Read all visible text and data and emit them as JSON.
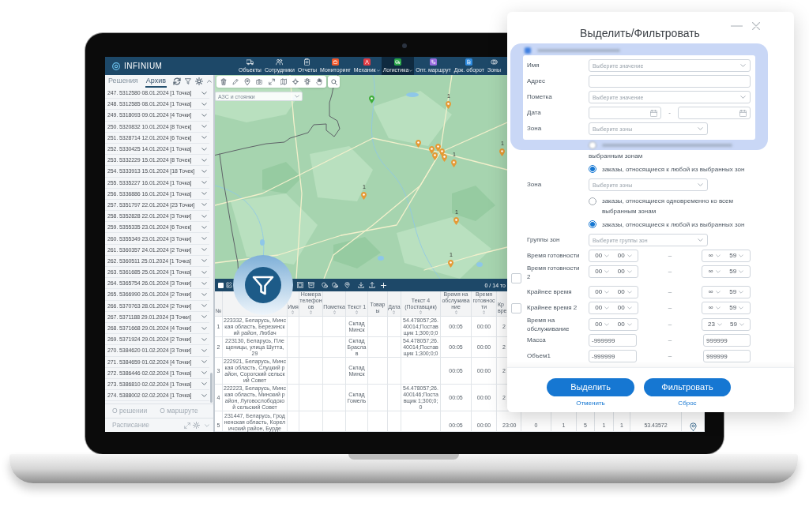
{
  "app": {
    "logo": "INFINIUM",
    "nav": [
      {
        "label": "Объекты",
        "kind": "outline",
        "has_menu": false,
        "selected": false
      },
      {
        "label": "Сотрудники",
        "kind": "outline",
        "has_menu": false,
        "selected": false
      },
      {
        "label": "Отчеты",
        "kind": "outline",
        "has_menu": false,
        "selected": false
      },
      {
        "label": "Мониторинг",
        "kind": "tile",
        "color": "#f0582c",
        "has_menu": false,
        "selected": false
      },
      {
        "label": "Механик",
        "kind": "tile",
        "color": "#e23d45",
        "has_menu": true,
        "selected": false
      },
      {
        "label": "Логистика",
        "kind": "tile",
        "color": "#2aa84a",
        "has_menu": true,
        "selected": true
      },
      {
        "label": "Опт. маршрут",
        "kind": "tile",
        "color": "#9a6ee0",
        "has_menu": false,
        "selected": false
      },
      {
        "label": "Док. оборот",
        "kind": "tile",
        "color": "#2e8be0",
        "has_menu": false,
        "selected": false
      },
      {
        "label": "Зоны",
        "kind": "outline",
        "has_menu": false,
        "selected": false
      }
    ]
  },
  "sidebar": {
    "tabs": [
      {
        "label": "Решения",
        "selected": false
      },
      {
        "label": "Архив",
        "selected": true
      }
    ],
    "items": [
      "247. 5312580 08.01.2024 [1 Точка]",
      "248. 5312585 08.01.2024 [1 Точка]",
      "249. 5318093 09.01.2024 [4 Точки]",
      "250. 5320832 10.01.2024 [8 Точек]",
      "251. 5328714 12.01.2024 [6 Точек]",
      "252. 5330425 14.01.2024 [1 Точка]",
      "253. 5332229 15.01.2024 [8 Точек]",
      "254. 5333913 15.01.2024 [18 Точек]",
      "255. 5335227 16.01.2024 [1 Точка]",
      "256. 5336886 16.01.2024 [1 Точка]",
      "257. 5351797 22.01.2024 [23 Точки]",
      "258. 5352828 22.01.2024 [3 Точки]",
      "259. 5355335 23.01.2024 [6 Точек]",
      "260. 5355349 23.01.2024 [3 Точки]",
      "261. 5360357 24.01.2024 [2 Точки]",
      "262. 5360511 25.01.2024 [1 Точка]",
      "263. 5361685 25.01.2024 [1 Точка]",
      "264. 5365754 26.01.2024 [3 Точки]",
      "265. 5366990 26.01.2024 [2 Точки]",
      "266. 5370763 28.01.2024 [2 Точки]",
      "267. 5371188 29.01.2024 [3 Точки]",
      "268. 5371668 29.01.2024 [4 Точки]",
      "269. 5371924 29.01.2024 [2 Точки]",
      "270. 5384620 01.02.2024 [3 Точки]",
      "271. 5384659 01.02.2024 [4 Точки]",
      "272. 5386446 02.02.2024 [1 Точка]",
      "273. 5386810 02.02.2024 [1 Точка]",
      "274. 5388002 02.02.2024 [1 Точка]"
    ],
    "sections": [
      {
        "label": "О решении"
      },
      {
        "label": "О маршруте"
      }
    ],
    "schedule": {
      "label": "Расписание"
    }
  },
  "map": {
    "layer_select": "АЗС и стоянки",
    "markers": [
      {
        "color": "#3fae3a"
      },
      {
        "color": "#e59a35",
        "label": "1"
      },
      {
        "color": "#e59a35"
      },
      {
        "color": "#e59a35"
      },
      {
        "color": "#e59a35"
      },
      {
        "color": "#e59a35"
      },
      {
        "color": "#e59a35"
      },
      {
        "color": "#e59a35"
      },
      {
        "color": "#e59a35",
        "label": "1"
      },
      {
        "color": "#e59a35",
        "label": "1"
      },
      {
        "color": "#e59a35",
        "label": "1"
      },
      {
        "color": "#e59a35",
        "label": "1"
      },
      {
        "color": "#e59a35",
        "label": "1"
      }
    ]
  },
  "table": {
    "select_all_checked": false,
    "counter": "0 / 14 то",
    "columns": [
      {
        "label": "№",
        "sortable": false
      },
      null,
      {
        "label": "Имя",
        "sortable": true
      },
      {
        "label": "Номера телефонов",
        "sortable": true
      },
      {
        "label": "Пометка",
        "sortable": true
      },
      {
        "label": "Текст 1",
        "sortable": true
      },
      {
        "label": "Товары",
        "sortable": false
      },
      {
        "label": "Дата",
        "sortable": true
      },
      {
        "label": "Текст 4 (Поставщик)",
        "sortable": true
      },
      {
        "label": "Время на обслуживание",
        "sortable": true
      },
      {
        "label": "Время готовности",
        "sortable": true
      },
      {
        "label": "Кр вре",
        "sortable": false
      }
    ],
    "rows": [
      {
        "cells": [
          "1",
          "223332, Беларусь, Минская область, Березинский район, Любач",
          null,
          null,
          null,
          "Склад Минск",
          null,
          null,
          "54.478057;26.40014;Поставщик 1;300;0;0",
          "00:05",
          "00:00",
          "2"
        ]
      },
      {
        "cells": [
          "2",
          "223130, Беларусь, Плещеницы, улица Шутта, 29",
          null,
          null,
          null,
          "Склад Браслав",
          null,
          null,
          "54.478057;26.40014;Поставщик 1;300;0;0",
          "00:05",
          "00:00",
          "2"
        ]
      },
      {
        "cells": [
          "3",
          "222921, Беларусь, Минская область, Слуцкий район, Сорогский сельский Совет",
          null,
          null,
          null,
          "Склад Минск",
          null,
          null,
          null,
          "00:05",
          "00:00",
          "2"
        ]
      },
      {
        "cells": [
          "4",
          "222223, Беларусь, Минская область, Минский район, Луговослободской сельский Совет",
          null,
          null,
          null,
          "Склад Гомель",
          null,
          null,
          "54.478057;26.400146;Поставщик 1;300;0;0",
          "00:05",
          "00:00",
          "2"
        ]
      },
      {
        "cells": [
          "5",
          "231447, Беларусь, Гродненская область, Кореличский район, Бурде",
          null,
          null,
          null,
          null,
          null,
          null,
          null,
          "00:05",
          "00:00",
          "23:00",
          "0",
          "1",
          "5",
          "1",
          "1",
          "53.43572"
        ],
        "map_pin": true
      }
    ]
  },
  "dialog": {
    "title": "Выделить/Фильтровать",
    "highlight_fields": [
      {
        "kind": "select",
        "label": "Имя",
        "placeholder": "Выберите значение"
      },
      {
        "kind": "text",
        "label": "Адрес"
      },
      {
        "kind": "select",
        "label": "Пометка",
        "placeholder": "Выберите значение"
      },
      {
        "kind": "date_range",
        "label": "Дата",
        "separator": "-"
      },
      {
        "kind": "select",
        "label": "Зона",
        "placeholder": "Выберите зоны"
      }
    ],
    "options": [
      {
        "kind": "note",
        "label": "выбранным зонам"
      },
      {
        "kind": "radio",
        "label": "заказы, относящиеся к любой из выбранных зон",
        "selected": true
      },
      {
        "kind": "select",
        "label": "Зона",
        "placeholder": "Выберите зоны"
      },
      {
        "kind": "radio",
        "label": "заказы, относящиеся одновременно ко всем выбранным зонам",
        "selected": false
      },
      {
        "kind": "radio",
        "label": "заказы, относящиеся к любой из выбранных зон",
        "selected": true
      },
      {
        "kind": "select",
        "label": "Группы зон",
        "placeholder": "Выберите группы зон"
      },
      {
        "kind": "time",
        "label": "Время готовности",
        "from": [
          "00",
          "00"
        ],
        "separator": "–",
        "to": [
          "∞",
          "59"
        ]
      },
      {
        "kind": "time",
        "label": "Время готовности 2",
        "checkbox": {
          "checked": false
        },
        "from": [
          "00",
          "00"
        ],
        "separator": "–",
        "to": [
          "∞",
          "59"
        ]
      },
      {
        "kind": "time",
        "label": "Крайнее время",
        "from": [
          "00",
          "00"
        ],
        "separator": "–",
        "to": [
          "∞",
          "59"
        ]
      },
      {
        "kind": "time",
        "label": "Крайнее время 2",
        "checkbox": {
          "checked": false
        },
        "from": [
          "00",
          "00"
        ],
        "separator": "–",
        "to": [
          "∞",
          "59"
        ]
      },
      {
        "kind": "time",
        "label": "Время на обслуживание",
        "from": [
          "00",
          "00"
        ],
        "separator": "–",
        "to": [
          "23",
          "59"
        ]
      },
      {
        "kind": "number",
        "label": "Масса",
        "from": "-999999",
        "separator": "–",
        "to": "999999"
      },
      {
        "kind": "number",
        "label": "Объем1",
        "from": "-999999",
        "separator": "–",
        "to": "999999"
      }
    ],
    "buttons": [
      {
        "label": "Выделить"
      },
      {
        "label": "Фильтровать"
      }
    ],
    "links": [
      {
        "label": "Отменить"
      },
      {
        "label": "Сброс"
      }
    ]
  }
}
